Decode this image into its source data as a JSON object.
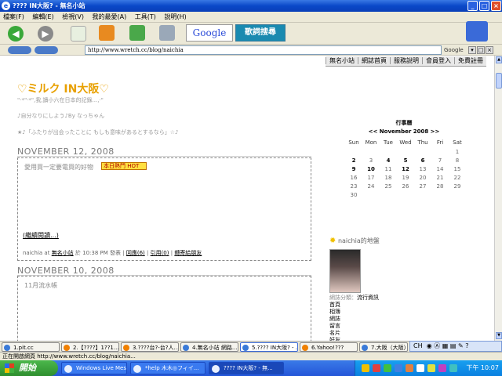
{
  "window": {
    "title": "???? IN大阪? - 無名小站"
  },
  "menu": [
    "檔案(F)",
    "編輯(E)",
    "檢視(V)",
    "我的最愛(A)",
    "工具(T)",
    "說明(H)"
  ],
  "toolbar": {
    "google_label": "Google",
    "dict_label": "歌詞搜尋"
  },
  "address": {
    "url": "http://www.wretch.cc/blog/naichia",
    "google_label": "Google"
  },
  "nav": [
    "無名小站",
    "網誌首頁",
    "服務說明",
    "會員登入",
    "免費註冊"
  ],
  "blog": {
    "title": "♡ミルク IN大阪♡",
    "subtitle1": "\"‧*\"‧*\",我,讀小六在日本的記錄...,‧\"",
    "subtitle2": "♪自分なりにしよう♪By なっちゃん",
    "subtitle3": "★♪「ふたりが出会ったことに もしも意味があるとするなら」☆♪"
  },
  "posts": [
    {
      "date": "NOVEMBER 12, 2008",
      "title": "愛用買一定要電買的好物",
      "badge": "本日熱門 HOT",
      "readmore": "(繼續閱讀...)",
      "meta_author": "naichia at",
      "meta_site": "無名小站",
      "meta_time": "於 10:38 PM 發表",
      "meta_reply": "回應(6)",
      "meta_ref": "引用(0)",
      "meta_recommend": "轉寄給朋友"
    },
    {
      "date": "NOVEMBER 10, 2008",
      "title": "11月流水帳"
    }
  ],
  "calendar": {
    "title": "行事曆",
    "month": "<< November 2008 >>",
    "weekdays": [
      "Sun",
      "Mon",
      "Tue",
      "Wed",
      "Thu",
      "Fri",
      "Sat"
    ],
    "rows": [
      [
        "",
        "",
        "",
        "",
        "",
        "",
        "1"
      ],
      [
        "2",
        "3",
        "4",
        "5",
        "6",
        "7",
        "8"
      ],
      [
        "9",
        "10",
        "11",
        "12",
        "13",
        "14",
        "15"
      ],
      [
        "16",
        "17",
        "18",
        "19",
        "20",
        "21",
        "22"
      ],
      [
        "23",
        "24",
        "25",
        "26",
        "27",
        "28",
        "29"
      ],
      [
        "30",
        "",
        "",
        "",
        "",
        "",
        ""
      ]
    ],
    "bold_days": [
      "2",
      "4",
      "5",
      "6",
      "9",
      "10",
      "12"
    ]
  },
  "sidebar": {
    "widget_title": "naichia的地盤",
    "profile_gray": "網誌分類：",
    "profile_1": "流行資訊",
    "links": [
      "首頁",
      "相簿",
      "網誌",
      "留言",
      "名片",
      "好友"
    ]
  },
  "tabs": [
    "1.pit.cc",
    "2.【????】1??1...",
    "3.????台?-台?人...",
    "4.無名小站 網路...",
    "5.???? IN大阪? - ...",
    "6.Yahoo!???",
    "7.大阪（大阪）"
  ],
  "langbar": {
    "label": "CH"
  },
  "status": {
    "text": "正在開啟網頁 http://www.wretch.cc/blog/naichia..."
  },
  "taskbar": {
    "start_label": "開始",
    "tasks": [
      "Windows Live Messen...",
      "*help 木木◎フィイ...",
      "???? IN大阪? - 無..."
    ],
    "clock": "下午 10:07"
  }
}
